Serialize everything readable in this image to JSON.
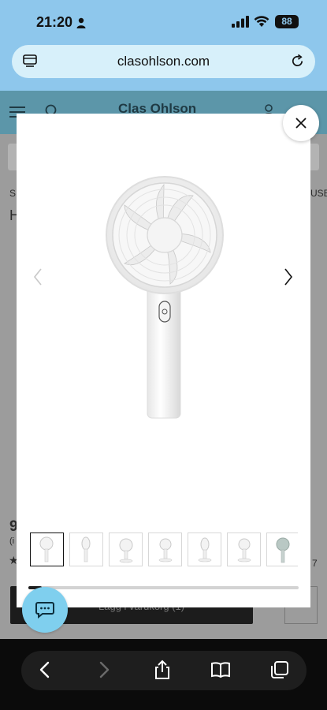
{
  "status_bar": {
    "time": "21:20",
    "battery": "88"
  },
  "browser": {
    "url": "clasohlson.com"
  },
  "site": {
    "logo": "Clas Ohlson"
  },
  "background_page": {
    "left_crumb": "S",
    "right_crumb": "USE",
    "heading_letter": "H",
    "price_partial": "9",
    "price_note_partial": "(i",
    "rating_partial": "★",
    "reviews_partial": "7",
    "cart_button_partial": "Lägg i varukorg (1)"
  },
  "modal": {
    "thumbnail_count": 7,
    "active_thumbnail": 1,
    "scroll_progress": 0.05
  },
  "colors": {
    "accent": "#7fcfee",
    "browser_bar": "#8ec7ec"
  }
}
